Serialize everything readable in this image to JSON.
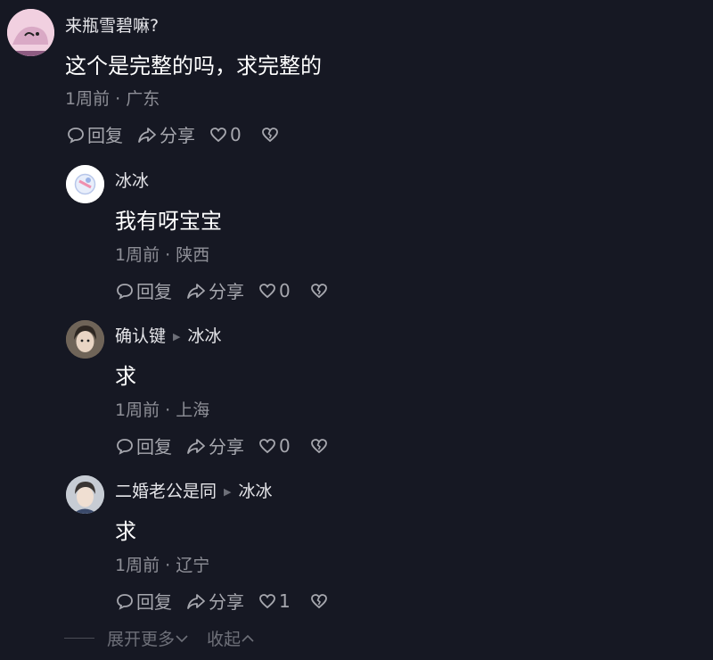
{
  "comments": [
    {
      "username": "来瓶雪碧嘛?",
      "text": "这个是完整的吗，求完整的",
      "time": "1周前",
      "location": "广东",
      "reply_label": "回复",
      "share_label": "分享",
      "like_count": "0"
    }
  ],
  "replies": [
    {
      "username": "冰冰",
      "reply_to": "",
      "text": "我有呀宝宝",
      "time": "1周前",
      "location": "陕西",
      "reply_label": "回复",
      "share_label": "分享",
      "like_count": "0"
    },
    {
      "username": "确认键",
      "reply_to": "冰冰",
      "text": "求",
      "time": "1周前",
      "location": "上海",
      "reply_label": "回复",
      "share_label": "分享",
      "like_count": "0"
    },
    {
      "username": "二婚老公是同",
      "reply_to": "冰冰",
      "text": "求",
      "time": "1周前",
      "location": "辽宁",
      "reply_label": "回复",
      "share_label": "分享",
      "like_count": "1"
    }
  ],
  "footer": {
    "expand_label": "展开更多",
    "collapse_label": "收起"
  },
  "separator": "·",
  "colors": {
    "background": "#161823",
    "text_primary": "#ffffff",
    "text_secondary": "#8e8f97",
    "icon": "#a6a7ae"
  }
}
